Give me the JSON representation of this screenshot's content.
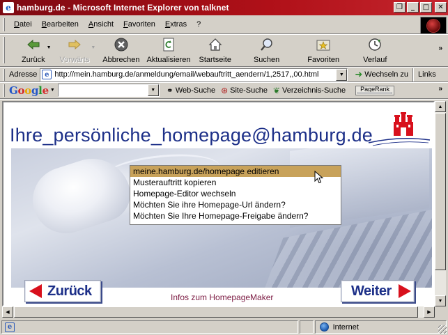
{
  "window": {
    "title": "hamburg.de - Microsoft Internet Explorer von talknet",
    "app_icon": "ie-e-icon"
  },
  "menu": [
    "Datei",
    "Bearbeiten",
    "Ansicht",
    "Favoriten",
    "Extras",
    "?"
  ],
  "toolbar": {
    "back": "Zurück",
    "forward": "Vorwärts",
    "stop": "Abbrechen",
    "refresh": "Aktualisieren",
    "home": "Startseite",
    "search": "Suchen",
    "favorites": "Favoriten",
    "history": "Verlauf"
  },
  "address": {
    "label": "Adresse",
    "url": "http://mein.hamburg.de/anmeldung/email/webauftritt_aendern/1,2517,,00.html",
    "go_label": "Wechseln zu",
    "links_label": "Links"
  },
  "google_bar": {
    "logo": [
      "G",
      "o",
      "o",
      "g",
      "l",
      "e"
    ],
    "search_value": "",
    "web_search": "Web-Suche",
    "site_search": "Site-Suche",
    "directory_search": "Verzeichnis-Suche",
    "pagerank": "PageRank"
  },
  "page": {
    "heading": "Ihre_persönliche_homepage@hamburg.de",
    "menu_options": [
      "meine.hamburg.de/homepage editieren",
      "Musterauftritt kopieren",
      "Homepage-Editor wechseln",
      "Möchten Sie ihre Homepage-Url ändern?",
      "Möchten Sie Ihre Homepage-Freigabe ändern?"
    ],
    "selected_index": 0,
    "back_button": "Zurück",
    "next_button": "Weiter",
    "info_link": "Infos zum HomepageMaker"
  },
  "status": {
    "text": "",
    "zone": "Internet"
  },
  "colors": {
    "titlebar": "#b01018",
    "heading": "#1c2f88",
    "selected": "#c8a25a",
    "arrow": "#d8101c"
  }
}
